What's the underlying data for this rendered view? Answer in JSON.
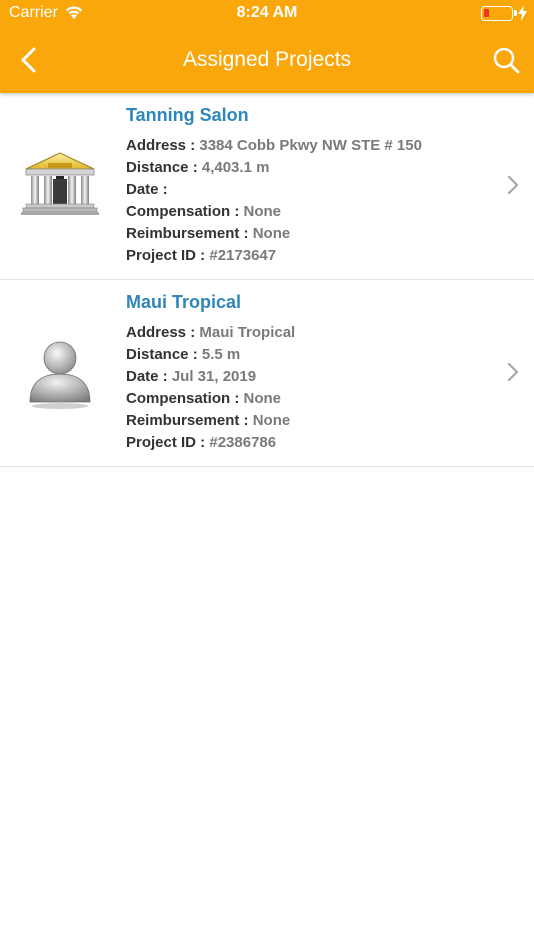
{
  "status_bar": {
    "carrier": "Carrier",
    "time": "8:24 AM"
  },
  "nav": {
    "title": "Assigned Projects",
    "back_icon": "chevron-left-icon",
    "search_icon": "search-icon"
  },
  "colors": {
    "accent": "#f9a70b",
    "project_name": "#2f86b8",
    "battery_low": "#e8362b"
  },
  "battery": {
    "level": 0.1
  },
  "projects": [
    {
      "name": "Tanning Salon",
      "icon": "bank-building-icon",
      "address_label": "Address : ",
      "address": "3384 Cobb Pkwy NW STE # 150",
      "distance_label": "Distance : ",
      "distance": "4,403.1 m",
      "date_label": "Date : ",
      "date": "",
      "compensation_label": "Compensation : ",
      "compensation": "None",
      "reimbursement_label": "Reimbursement : ",
      "reimbursement": "None",
      "project_id_label": "Project ID : ",
      "project_id": "#2173647"
    },
    {
      "name": "Maui Tropical",
      "icon": "user-avatar-icon",
      "address_label": "Address : ",
      "address": "Maui Tropical",
      "distance_label": "Distance : ",
      "distance": "5.5 m",
      "date_label": "Date : ",
      "date": "Jul 31, 2019",
      "compensation_label": "Compensation : ",
      "compensation": "None",
      "reimbursement_label": "Reimbursement : ",
      "reimbursement": "None",
      "project_id_label": "Project ID : ",
      "project_id": "#2386786"
    }
  ]
}
